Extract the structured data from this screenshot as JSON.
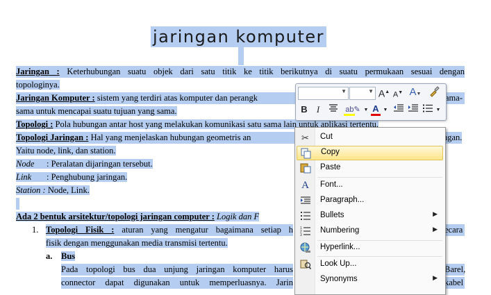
{
  "document": {
    "title": "jaringan komputer",
    "paragraphs": {
      "p1_line1_term": "Jaringan :",
      "p1_line1_rest": "Keterhubungan suatu objek dari satu titik ke titik berikutnya di suatu permukaan sesuai dengan",
      "p1_line2": "topologinya.",
      "p2_line1_term": "Jaringan Komputer :",
      "p2_line1_rest": "sistem yang terdiri atas komputer dan perangk",
      "p2_line1_end": "ama-",
      "p2_line2": "sama untuk mencapai suatu tujuan yang sama.",
      "p3_term": "Topologi :",
      "p3_rest": "Pola hubungan antar host yang melakukan komunikasi satu sama lain untuk aplikasi tertentu.",
      "p4_term": "Topologi Jaringan :",
      "p4_rest": "Hal yang menjelaskan hubungan geometris an",
      "p4_end": "ngan.",
      "p4_line2": "Yaitu node, link, dan station.",
      "def1_term": "Node",
      "def1_text": ": Peralatan dijaringan tersebut.",
      "def2_term": "Link",
      "def2_text": ": Penghubung jaringan.",
      "def3_term": "Station :",
      "def3_text": "Node, Link.",
      "arch_heading": "Ada 2 bentuk arsitektur/topologi jaringan computer :",
      "arch_italic": "Logik dan F",
      "item1_num": "1.",
      "item1_term": "Topologi Fisik :",
      "item1_rest": "aturan yang mengatur bagaimana setiap h",
      "item1_end": "ecara",
      "item1_line2": "fisik dengan menggunakan media transmisi tertentu.",
      "sub_a_num": "a.",
      "sub_a_term": "Bus",
      "bus_line1": "Pada topologi bus dua unjung jaringan komputer harus",
      "bus_line1_end": "Barel,",
      "bus_line2": "connector dapat digunakan untuk memperluasnya. Jarin",
      "bus_line2_end": "kabel"
    }
  },
  "mini_toolbar": {
    "font_name": "",
    "font_size": "",
    "grow_font": "A",
    "shrink_font": "A",
    "styles": "A",
    "bold": "B",
    "italic": "I"
  },
  "context_menu": {
    "items": [
      {
        "label": "Cut",
        "icon": "scissors-icon"
      },
      {
        "label": "Copy",
        "icon": "copy-icon"
      },
      {
        "label": "Paste",
        "icon": "paste-icon"
      },
      {
        "label": "Font...",
        "icon": "font-icon"
      },
      {
        "label": "Paragraph...",
        "icon": "paragraph-icon"
      },
      {
        "label": "Bullets",
        "icon": "bullets-icon"
      },
      {
        "label": "Numbering",
        "icon": "numbering-icon"
      },
      {
        "label": "Hyperlink...",
        "icon": "hyperlink-icon"
      },
      {
        "label": "Look Up...",
        "icon": "lookup-icon"
      },
      {
        "label": "Synonyms",
        "icon": ""
      }
    ],
    "highlighted_color": "#ffe58a"
  },
  "colors": {
    "selection": "#b4cdf0",
    "font_color_bar": "#e00000",
    "highlight_bar": "#ffff00"
  }
}
